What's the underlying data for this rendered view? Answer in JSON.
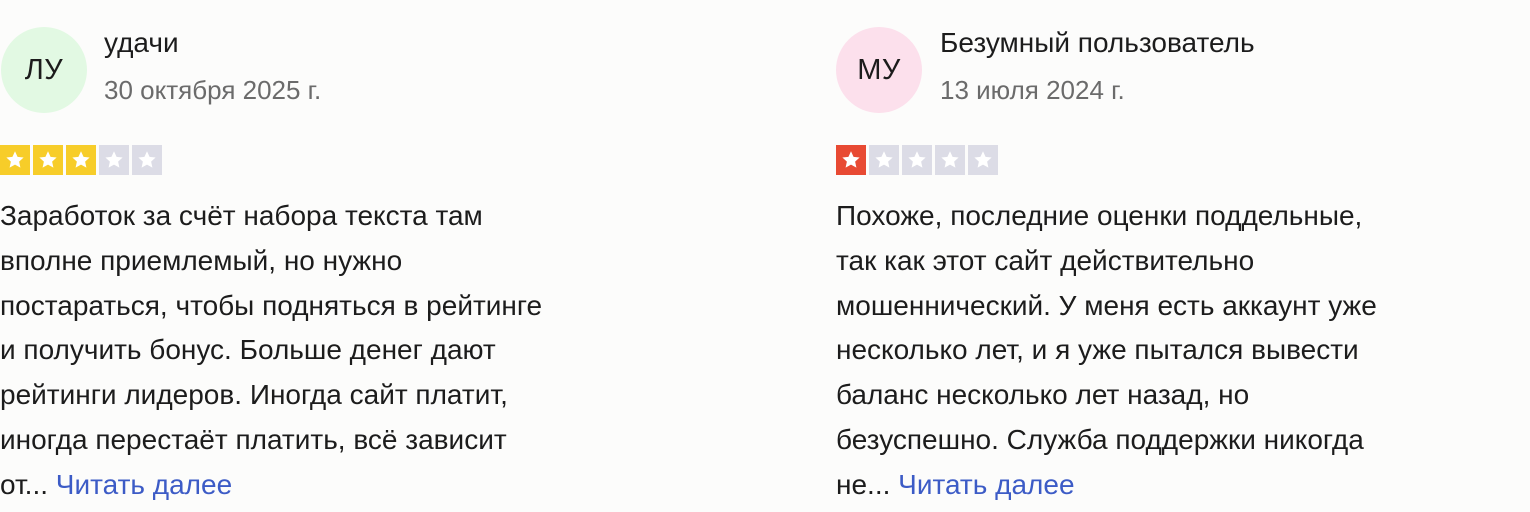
{
  "reviews": [
    {
      "avatar_initials": "ЛУ",
      "avatar_color": "#e2f9e3",
      "author": "удачи",
      "date": "30 октября 2025 г.",
      "rating": 3,
      "rating_max": 5,
      "star_color": "#f7cd29",
      "empty_star_color": "#dcdce6",
      "text_lines": [
        "Заработок за счёт набора текста там",
        "вполне приемлемый, но нужно",
        "постараться, чтобы подняться в рейтинге",
        "и получить бонус. Больше денег дают",
        "рейтинги лидеров. Иногда сайт платит,",
        "иногда перестаёт платить, всё зависит",
        "от..."
      ],
      "read_more": "Читать далее"
    },
    {
      "avatar_initials": "МУ",
      "avatar_color": "#fce0ec",
      "author": "Безумный пользователь",
      "date": "13 июля 2024 г.",
      "rating": 1,
      "rating_max": 5,
      "star_color": "#e84a33",
      "empty_star_color": "#dcdce6",
      "text_lines": [
        "Похоже, последние оценки поддельные,",
        "так как этот сайт действительно",
        "мошеннический. У меня есть аккаунт уже",
        "несколько лет, и я уже пытался вывести",
        "баланс несколько лет назад, но",
        "безуспешно. Служба поддержки никогда",
        "не..."
      ],
      "read_more": "Читать далее"
    }
  ]
}
